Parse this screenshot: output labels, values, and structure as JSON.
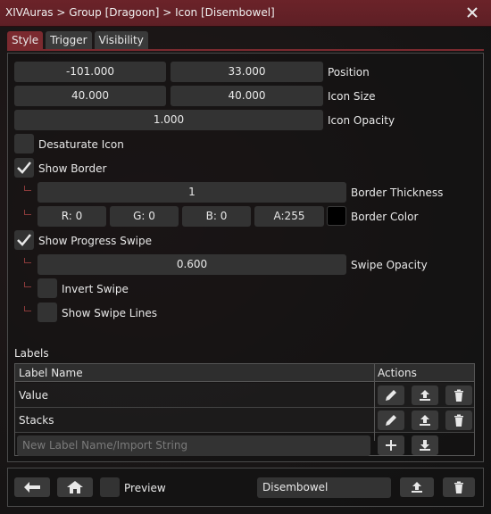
{
  "window": {
    "title": "XIVAuras > Group [Dragoon] > Icon [Disembowel]"
  },
  "tabs": [
    {
      "label": "Style",
      "active": true
    },
    {
      "label": "Trigger",
      "active": false
    },
    {
      "label": "Visibility",
      "active": false
    }
  ],
  "style": {
    "position": {
      "x": "-101.000",
      "y": "33.000",
      "label": "Position"
    },
    "icon_size": {
      "w": "40.000",
      "h": "40.000",
      "label": "Icon Size"
    },
    "icon_opacity": {
      "value": "1.000",
      "label": "Icon Opacity"
    },
    "desaturate": {
      "label": "Desaturate Icon",
      "checked": false
    },
    "show_border": {
      "label": "Show Border",
      "checked": true
    },
    "border_thickness": {
      "value": "1",
      "label": "Border Thickness"
    },
    "border_color": {
      "r": "R:  0",
      "g": "G:  0",
      "b": "B:  0",
      "a": "A:255",
      "label": "Border Color",
      "swatch": "#000000"
    },
    "show_progress_swipe": {
      "label": "Show Progress Swipe",
      "checked": true
    },
    "swipe_opacity": {
      "value": "0.600",
      "label": "Swipe Opacity"
    },
    "invert_swipe": {
      "label": "Invert Swipe",
      "checked": false
    },
    "show_swipe_lines": {
      "label": "Show Swipe Lines",
      "checked": false
    }
  },
  "labels": {
    "heading": "Labels",
    "columns": [
      "Label Name",
      "Actions"
    ],
    "rows": [
      {
        "name": "Value"
      },
      {
        "name": "Stacks"
      }
    ],
    "new_placeholder": "New Label Name/Import String"
  },
  "footer": {
    "preview_label": "Preview",
    "preview_checked": false,
    "name_value": "Disembowel"
  },
  "colors": {
    "accent": "#7b2a2f",
    "title_bar": "#6b2329",
    "field": "#333333"
  }
}
